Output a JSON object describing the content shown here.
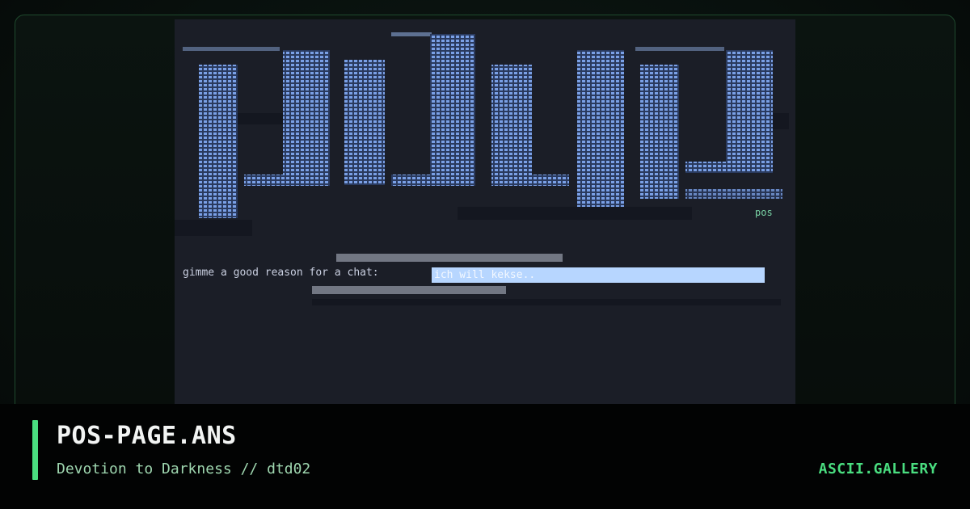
{
  "card": {
    "title": "POS-PAGE.ANS",
    "subtitle": "Devotion to Darkness // dtd02",
    "brand": "ASCII.GALLERY"
  },
  "artwork": {
    "prompt_label": "gimme a good reason for a chat:",
    "prompt_value": "ich will kekse..",
    "corner_tag": "pos"
  },
  "colors": {
    "accent": "#4ade80",
    "art_background": "#1b1e27",
    "block_blue": "#6b93d9"
  }
}
